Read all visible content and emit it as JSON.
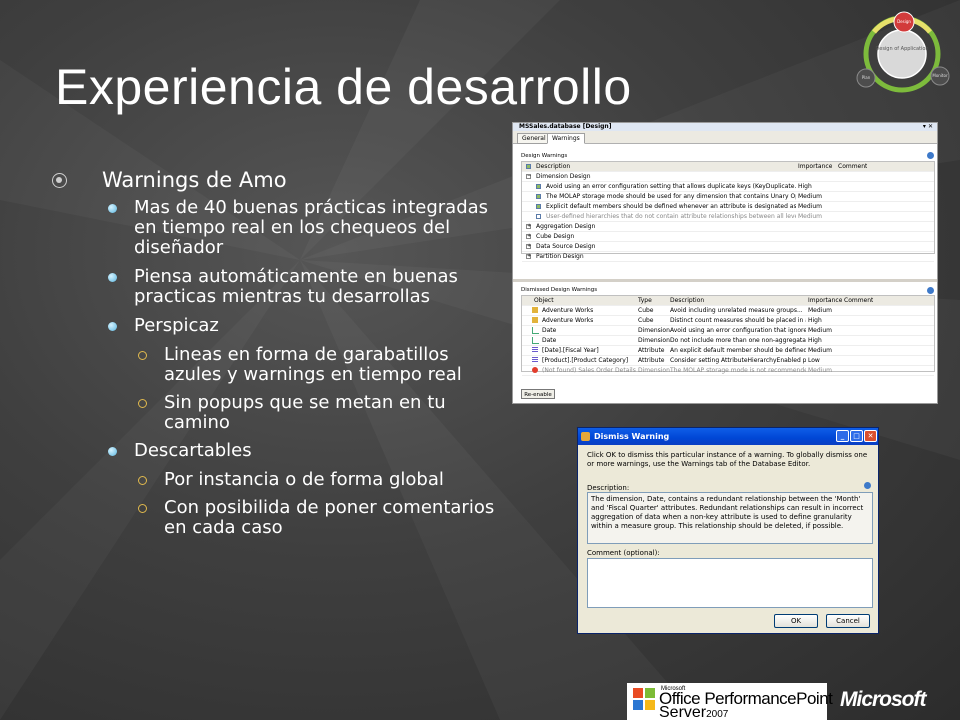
{
  "slide": {
    "title": "Experiencia de desarrollo",
    "cycle_diagram": {
      "top": "Design",
      "center": "Design of Application",
      "left": "Plan",
      "right": "Monitor"
    },
    "colors": {
      "background": "#3f3f3f",
      "title": "#ffffff",
      "bullet_l2": "#5ab6e0",
      "bullet_l3": "#e0b94e"
    }
  },
  "bullets": {
    "b1": "Warnings de Amo",
    "b1_1": "Mas de 40 buenas prácticas integradas en tiempo real en los chequeos del diseñador",
    "b1_2": "Piensa automáticamente en buenas practicas mientras tu desarrollas",
    "b1_3": "Perspicaz",
    "b1_3_1": "Lineas en forma de garabatillos azules y warnings en tiempo real",
    "b1_3_2": "Sin popups que se metan en tu camino",
    "b1_4": "Descartables",
    "b1_4_1": "Por instancia o de forma global",
    "b1_4_2": "Con posibilida de poner comentarios en cada caso"
  },
  "editor": {
    "title": "MSSales.database [Design]",
    "tabs": [
      "General",
      "Warnings"
    ],
    "design_warnings": {
      "label": "Design Warnings",
      "headers": [
        "Description",
        "Importance",
        "Comment"
      ],
      "group_dimension": "Dimension Design",
      "rows": [
        {
          "desc": "Avoid using an error configuration setting that allows duplicate keys (KeyDuplicate...",
          "imp": "High",
          "checked": true
        },
        {
          "desc": "The MOLAP storage mode should be used for any dimension that contains Unary Operators,...",
          "imp": "Medium",
          "checked": true
        },
        {
          "desc": "Explicit default members should be defined whenever an attribute is designated as...",
          "imp": "Medium",
          "checked": true
        },
        {
          "desc": "User-defined hierarchies that do not contain attribute relationships between all levels...",
          "imp": "Medium",
          "checked": false
        }
      ],
      "groups_collapsed": [
        "Aggregation Design",
        "Cube Design",
        "Data Source Design",
        "Partition Design"
      ]
    },
    "dismissed_warnings": {
      "label": "Dismissed Design Warnings",
      "headers": [
        "Object",
        "Type",
        "Description",
        "Importance",
        "Comment"
      ],
      "rows": [
        {
          "obj": "Adventure Works",
          "type": "Cube",
          "desc": "Avoid including unrelated measure groups...",
          "imp": "Medium"
        },
        {
          "obj": "Adventure Works",
          "type": "Cube",
          "desc": "Distinct count measures should be placed in a dedicated...",
          "imp": "High"
        },
        {
          "obj": "Date",
          "type": "Dimension",
          "desc": "Avoid using an error configuration that ignores keys...",
          "imp": "Medium"
        },
        {
          "obj": "Date",
          "type": "Dimension",
          "desc": "Do not include more than one non-aggregatable attribute...",
          "imp": "High"
        },
        {
          "obj": "[Date].[Fiscal Year]",
          "type": "Attribute",
          "desc": "An explicit default member should be defined for...",
          "imp": "Medium"
        },
        {
          "obj": "[Product].[Product Category]",
          "type": "Attribute",
          "desc": "Consider setting AttributeHierarchyEnabled property...",
          "imp": "Low"
        },
        {
          "obj": "(Not found) Sales Order Details",
          "type": "Dimension",
          "desc": "The MOLAP storage mode is not recommended for...",
          "imp": "Medium"
        }
      ],
      "reenable": "Re-enable"
    }
  },
  "dialog": {
    "title": "Dismiss Warning",
    "intro": "Click OK to dismiss this particular instance of a warning. To globally dismiss one or more warnings, use the Warnings tab of the Database Editor.",
    "desc_label": "Description:",
    "desc_text": "The dimension, Date, contains a redundant relationship between the 'Month' and 'Fiscal Quarter' attributes. Redundant relationships can result in incorrect aggregation of data when a non-key attribute is used to define granularity within a measure group. This relationship should be deleted, if possible.",
    "comment_label": "Comment (optional):",
    "comment_value": "",
    "ok": "OK",
    "cancel": "Cancel"
  },
  "footer": {
    "product_small": "Microsoft",
    "product_line1": "Office PerformancePoint",
    "product_line2": "Server",
    "product_year": "2007",
    "company": "Microsoft"
  }
}
